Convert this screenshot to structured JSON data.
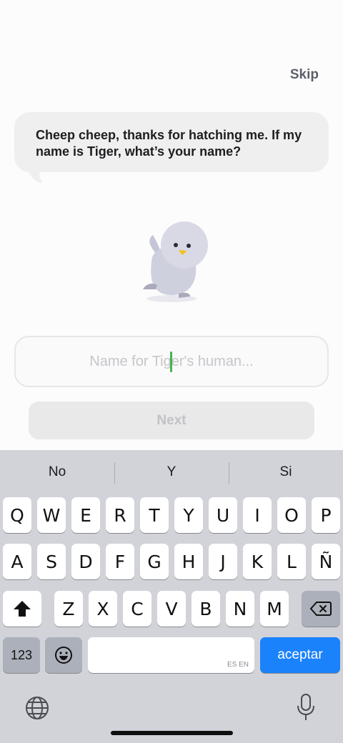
{
  "header": {
    "skip_label": "Skip"
  },
  "bubble": {
    "text": "Cheep cheep, thanks for hatching me. If my name is Tiger, what’s your name?"
  },
  "form": {
    "name_placeholder": "Name for Tiger's human...",
    "name_value": "",
    "next_label": "Next"
  },
  "keyboard": {
    "suggestions": [
      "No",
      "Y",
      "Si"
    ],
    "rows": [
      [
        "Q",
        "W",
        "E",
        "R",
        "T",
        "Y",
        "U",
        "I",
        "O",
        "P"
      ],
      [
        "A",
        "S",
        "D",
        "F",
        "G",
        "H",
        "J",
        "K",
        "L",
        "Ñ"
      ],
      [
        "Z",
        "X",
        "C",
        "V",
        "B",
        "N",
        "M"
      ]
    ],
    "numbers_label": "123",
    "space_hint": "ES EN",
    "return_label": "aceptar"
  },
  "colors": {
    "caret": "#45b649",
    "return_key": "#1a82fb"
  }
}
